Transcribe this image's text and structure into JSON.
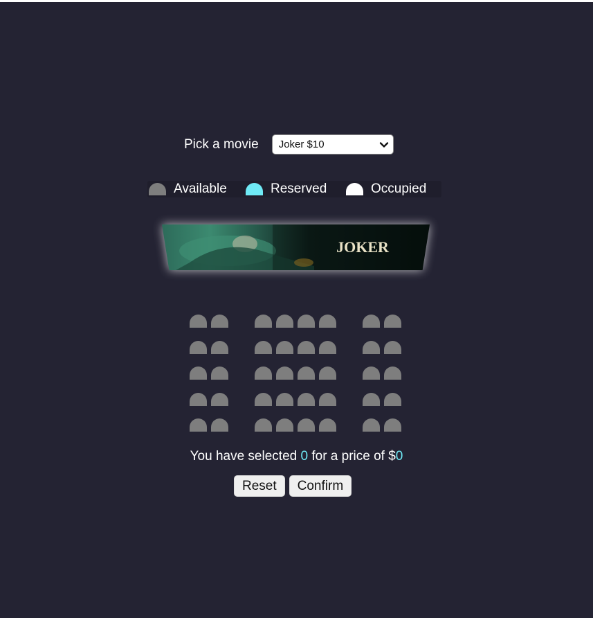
{
  "picker": {
    "label": "Pick a movie",
    "selected": "Joker $10",
    "chevron_icon": "chevron-down-icon"
  },
  "legend": [
    {
      "label": "Available",
      "color": "#7e7e7e"
    },
    {
      "label": "Reserved",
      "color": "#6feaf6"
    },
    {
      "label": "Occupied",
      "color": "#ffffff"
    }
  ],
  "screen": {
    "poster_text": "JOKER"
  },
  "seating": {
    "rows": 5,
    "blocks": [
      2,
      4,
      2
    ],
    "state": "available"
  },
  "summary": {
    "prefix": "You have selected",
    "count": "0",
    "middle": "for a price of $",
    "price": "0"
  },
  "buttons": {
    "reset": "Reset",
    "confirm": "Confirm"
  },
  "colors": {
    "background": "#242333",
    "available": "#7e7e7e",
    "reserved": "#6feaf6",
    "occupied": "#ffffff"
  }
}
